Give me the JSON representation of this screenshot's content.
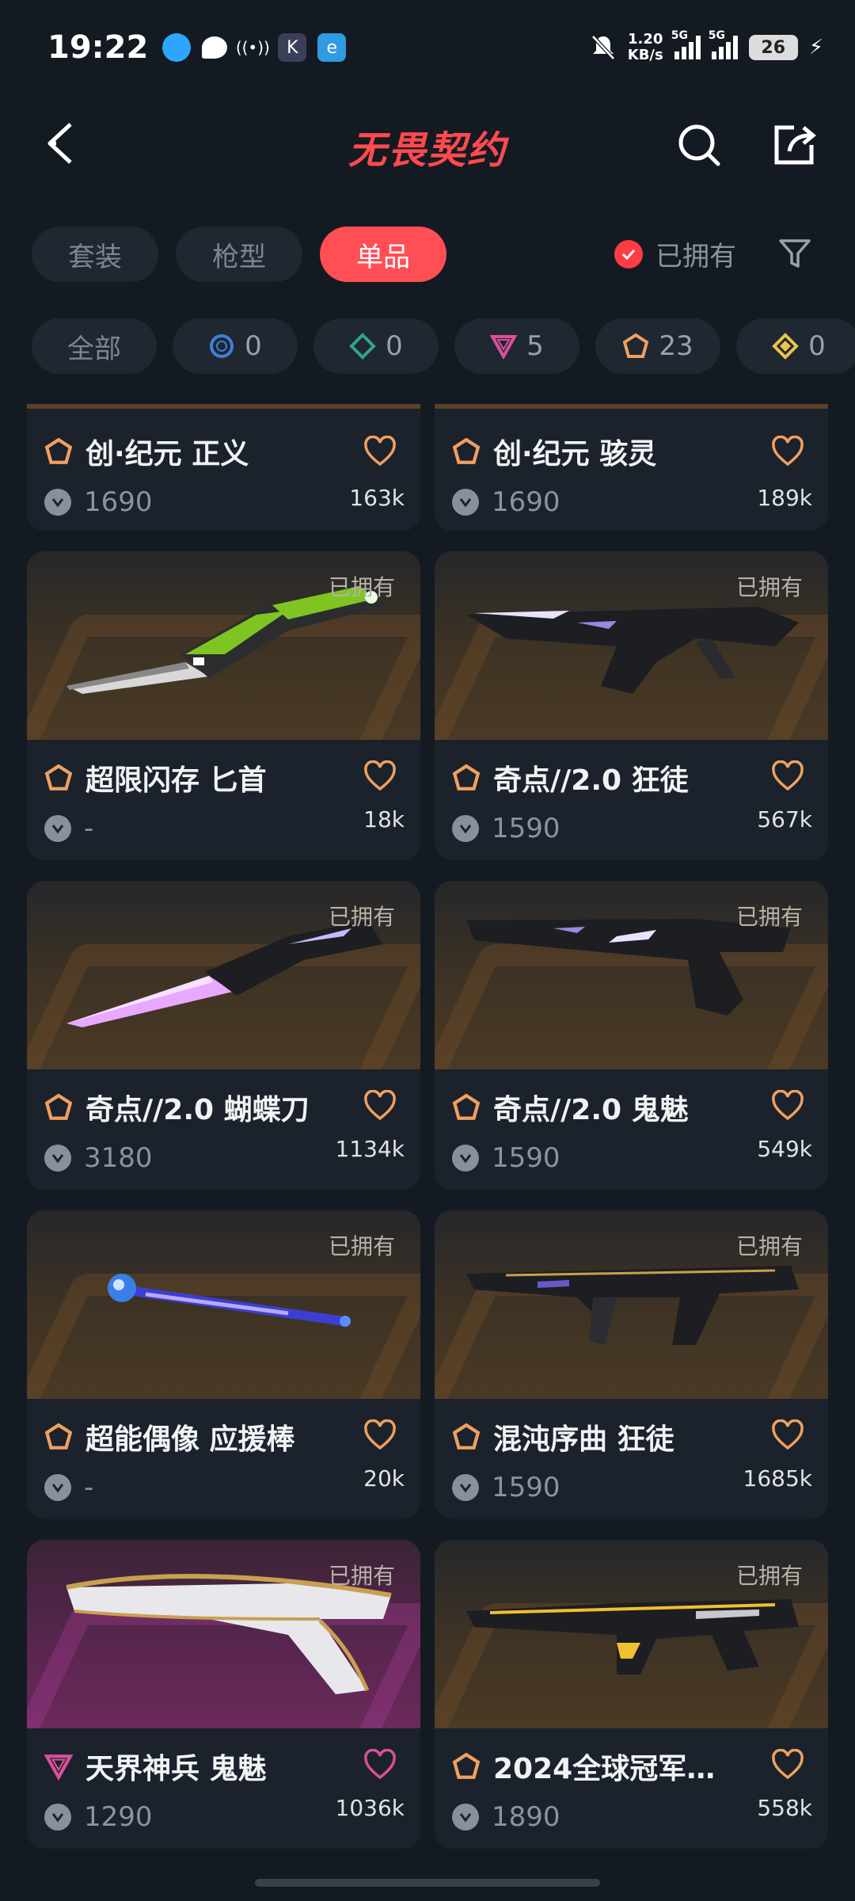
{
  "status_bar": {
    "time": "19:22",
    "net_speed_value": "1.20",
    "net_speed_unit": "KB/s",
    "network_1": "5G",
    "network_2": "5G",
    "battery": "26"
  },
  "header": {
    "brand": "无畏契约"
  },
  "type_tabs": [
    {
      "label": "套装",
      "active": false
    },
    {
      "label": "枪型",
      "active": false
    },
    {
      "label": "单品",
      "active": true
    }
  ],
  "owned_filter": {
    "label": "已拥有",
    "checked": true
  },
  "tier_filter": [
    {
      "label": "全部"
    },
    {
      "icon": "tier-blue-icon",
      "color": "#3f7fd6",
      "count": "0"
    },
    {
      "icon": "tier-green-icon",
      "color": "#2fa58a",
      "count": "0"
    },
    {
      "icon": "tier-pink-icon",
      "color": "#d9509c",
      "count": "5"
    },
    {
      "icon": "tier-orange-icon",
      "color": "#f0a060",
      "count": "23"
    },
    {
      "icon": "tier-gold-icon",
      "color": "#e9c34a",
      "count": "0"
    }
  ],
  "items": [
    {
      "name": "创·纪元 正义",
      "price": "1690",
      "likes": "163k",
      "tier": "orange",
      "partial": true
    },
    {
      "name": "创·纪元 骇灵",
      "price": "1690",
      "likes": "189k",
      "tier": "orange",
      "partial": true
    },
    {
      "name": "超限闪存 匕首",
      "price": "-",
      "likes": "18k",
      "tier": "orange",
      "owned": "已拥有",
      "weapon": "knife-green"
    },
    {
      "name": "奇点//2.0 狂徒",
      "price": "1590",
      "likes": "567k",
      "tier": "orange",
      "owned": "已拥有",
      "weapon": "rifle-dark"
    },
    {
      "name": "奇点//2.0 蝴蝶刀",
      "price": "3180",
      "likes": "1134k",
      "tier": "orange",
      "owned": "已拥有",
      "weapon": "knife-purple"
    },
    {
      "name": "奇点//2.0 鬼魅",
      "price": "1590",
      "likes": "549k",
      "tier": "orange",
      "owned": "已拥有",
      "weapon": "pistol-dark"
    },
    {
      "name": "超能偶像 应援棒",
      "price": "-",
      "likes": "20k",
      "tier": "orange",
      "owned": "已拥有",
      "weapon": "lightstick"
    },
    {
      "name": "混沌序曲 狂徒",
      "price": "1590",
      "likes": "1685k",
      "tier": "orange",
      "owned": "已拥有",
      "weapon": "rifle-chaos"
    },
    {
      "name": "天界神兵 鬼魅",
      "price": "1290",
      "likes": "1036k",
      "tier": "pink",
      "owned": "已拥有",
      "weapon": "pistol-white"
    },
    {
      "name": "2024全球冠军…",
      "price": "1890",
      "likes": "558k",
      "tier": "orange",
      "owned": "已拥有",
      "weapon": "rifle-champ"
    }
  ],
  "colors": {
    "accent": "#ff4f55",
    "background": "#141a22",
    "card": "#1b222b",
    "tier_orange": "#f0a060",
    "tier_pink": "#d9509c"
  }
}
